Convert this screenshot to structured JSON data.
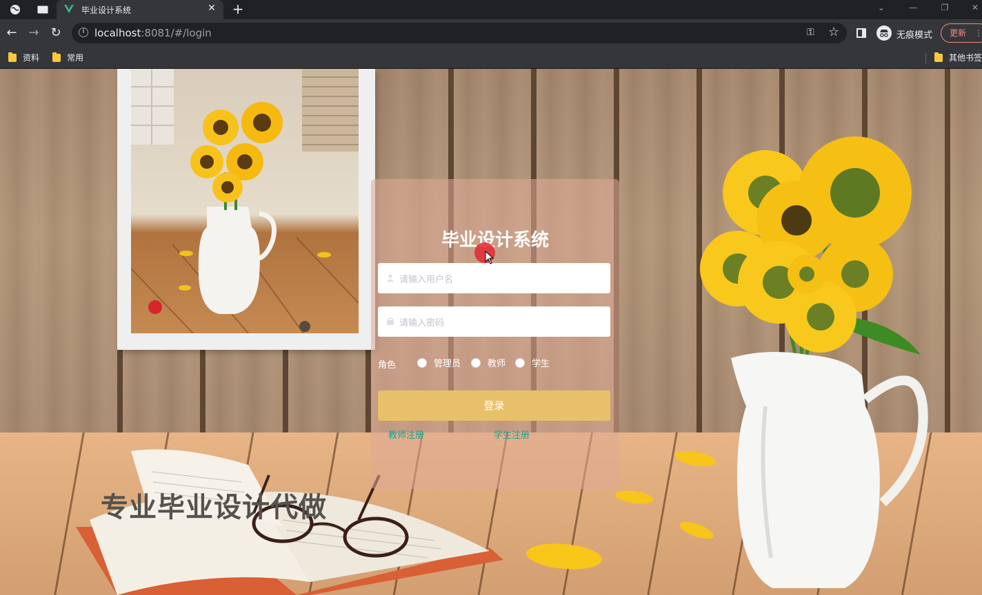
{
  "browser": {
    "tab_title": "毕业设计系统",
    "url_host": "localhost",
    "url_rest": ":8081/#/login",
    "incognito_label": "无痕模式",
    "update_label": "更新",
    "bookmarks": [
      "资料",
      "常用"
    ],
    "other_bookmarks": "其他书签"
  },
  "login": {
    "title": "毕业设计系统",
    "username_placeholder": "请输入用户名",
    "password_placeholder": "请输入密码",
    "role_label": "角色",
    "roles": [
      "管理员",
      "教师",
      "学生"
    ],
    "submit_label": "登录",
    "teacher_register": "教师注册",
    "student_register": "学生注册"
  },
  "background": {
    "slogan": "专业毕业设计代做"
  },
  "colors": {
    "accent_button": "#e9c06a",
    "link": "#16a38f",
    "panel_overlay": "rgba(222,170,150,0.55)"
  }
}
